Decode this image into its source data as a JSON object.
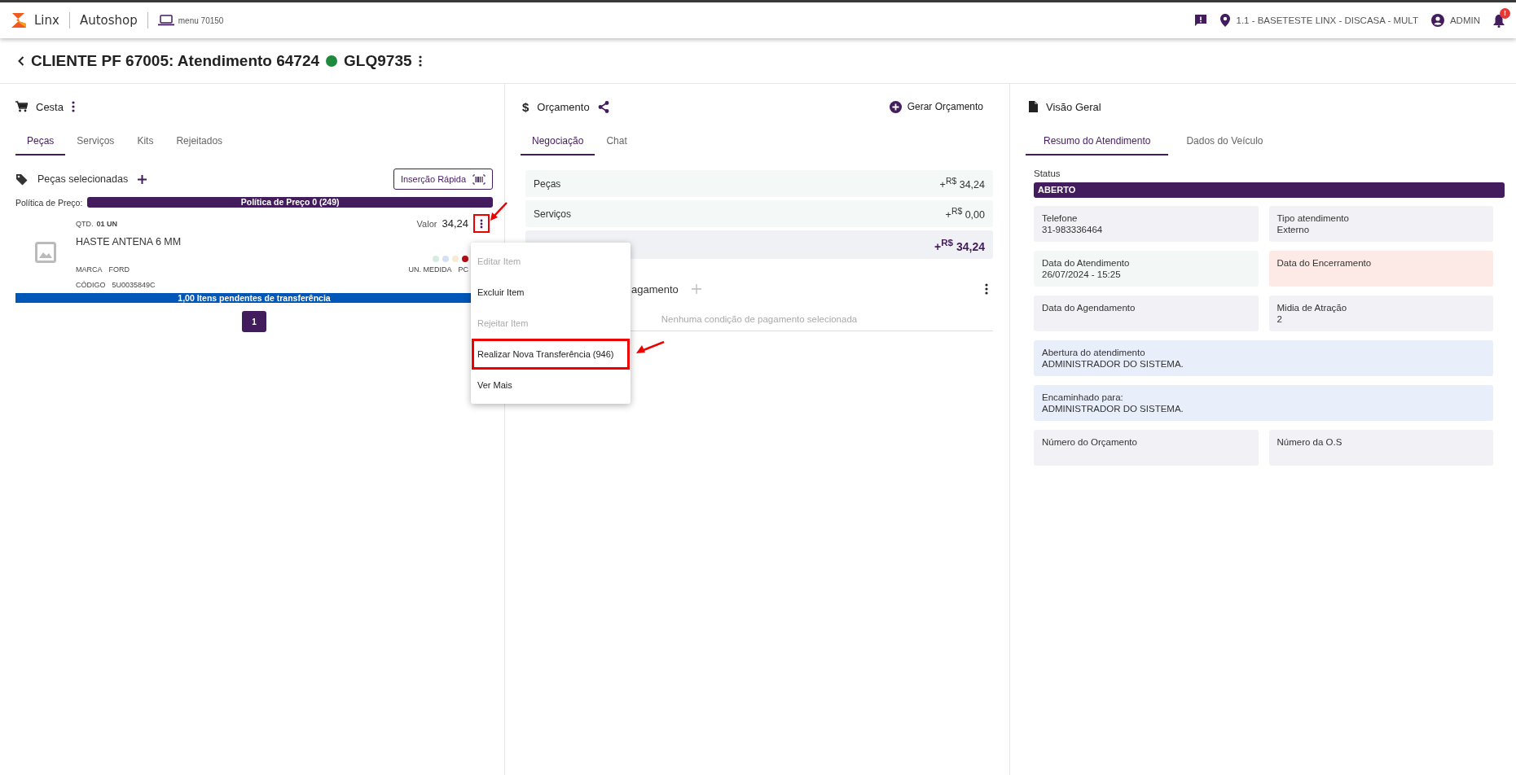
{
  "topbar": {
    "brand": "Linx",
    "product": "Autoshop",
    "menu_label": "menu 70150",
    "location": "1.1 - BASETESTE LINX - DISCASA - MULT",
    "user": "ADMIN",
    "notification_badge": "!"
  },
  "page_title": {
    "client": "CLIENTE PF 67005: Atendimento 64724",
    "status_dot": {
      "color": "#1e8a3e"
    },
    "plate": "GLQ9735"
  },
  "cesta": {
    "title": "Cesta",
    "tabs": [
      {
        "label": "Peças",
        "selected": true
      },
      {
        "label": "Serviços",
        "selected": false
      },
      {
        "label": "Kits",
        "selected": false
      },
      {
        "label": "Rejeitados",
        "selected": false
      }
    ],
    "section_title": "Peças selecionadas",
    "quick_insert": "Inserção Rápida",
    "price_policy_label": "Política de Preço:",
    "price_policy": "Política de Preço 0 (249)",
    "items": [
      {
        "qty_label": "QTD.",
        "qty": "01 UN",
        "name": "HASTE ANTENA 6 MM",
        "value_label": "Valor",
        "value": "34,24",
        "brand_label": "MARCA",
        "brand": "FORD",
        "code_label": "CÓDIGO",
        "code": "5U0035849C",
        "unit_label": "UN. MEDIDA",
        "unit": "PC",
        "menu_button_annotated": true,
        "dots": [
          {
            "color": "#d6ece0"
          },
          {
            "color": "#d4e1f5"
          },
          {
            "color": "#f6ecd4"
          },
          {
            "color": "#b00f14"
          }
        ],
        "pending": "1,00 Itens pendentes de transferência"
      }
    ],
    "pages": [
      {
        "label": "1",
        "selected": true
      }
    ]
  },
  "item_menu": {
    "items": [
      {
        "label": "Editar Item",
        "disabled": true,
        "annotated": false
      },
      {
        "label": "Excluir Item",
        "disabled": false,
        "annotated": false
      },
      {
        "label": "Rejeitar Item",
        "disabled": true,
        "annotated": false
      },
      {
        "label": "Realizar Nova Transferência (946)",
        "disabled": false,
        "annotated": true
      },
      {
        "label": "Ver Mais",
        "disabled": false,
        "annotated": false
      }
    ]
  },
  "orcamento": {
    "icon_char": "$",
    "title": "Orçamento",
    "action": "Gerar Orçamento",
    "tabs": [
      {
        "label": "Negociação",
        "selected": true
      },
      {
        "label": "Chat",
        "selected": false
      }
    ],
    "rows": [
      {
        "kind": "line",
        "label": "Peças",
        "sign": "+",
        "currency": "R$",
        "value": "34,24"
      },
      {
        "kind": "line",
        "label": "Serviços",
        "sign": "+",
        "currency": "R$",
        "value": "0,00"
      },
      {
        "kind": "total",
        "sign": "+",
        "currency": "R$",
        "value": "34,24"
      }
    ],
    "payment": {
      "title": "agamento",
      "empty": "Nenhuma condição de pagamento selecionada"
    }
  },
  "visao_geral": {
    "title": "Visão Geral",
    "tabs": [
      {
        "label": "Resumo do Atendimento",
        "selected": true
      },
      {
        "label": "Dados do Veículo",
        "selected": false
      }
    ],
    "status_label": "Status",
    "status": "ABERTO",
    "cards": [
      {
        "kind": "half",
        "color": "#f2f2f6",
        "label": "Telefone",
        "value": "31-983336464"
      },
      {
        "kind": "half",
        "color": "#f2f2f6",
        "label": "Tipo atendimento",
        "value": "Externo"
      },
      {
        "kind": "half",
        "color": "#f3f8f7",
        "label": "Data do Atendimento",
        "value": "26/07/2024 - 15:25"
      },
      {
        "kind": "half",
        "color": "#fdeae6",
        "label": "Data do Encerramento"
      },
      {
        "kind": "half",
        "color": "#f2f2f6",
        "label": "Data do Agendamento"
      },
      {
        "kind": "half",
        "color": "#f2f2f6",
        "label": "Midia de Atração",
        "value": "2"
      },
      {
        "kind": "full",
        "color": "#e9eefb",
        "label": "Abertura do atendimento",
        "value": "ADMINISTRADOR DO SISTEMA."
      },
      {
        "kind": "full",
        "color": "#e9eefb",
        "label": "Encaminhado para:",
        "value": "ADMINISTRADOR DO SISTEMA."
      },
      {
        "kind": "half",
        "color": "#f2f2f6",
        "label": "Número do Orçamento"
      },
      {
        "kind": "half",
        "color": "#f2f2f6",
        "label": "Número da O.S"
      }
    ]
  }
}
